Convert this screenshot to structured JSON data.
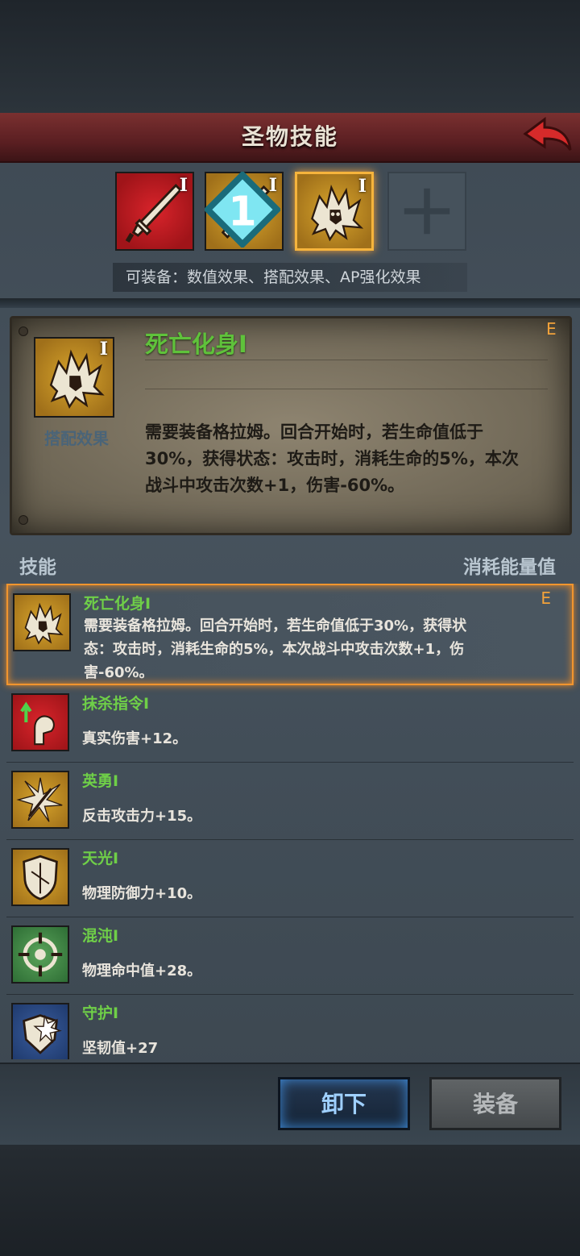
{
  "header": {
    "title": "圣物技能"
  },
  "slots": [
    {
      "icon": "sword-icon",
      "grade": "I",
      "color": "#c81e24"
    },
    {
      "icon": "broken-sword-icon",
      "grade": "I",
      "badge": "1",
      "color": "#c8922a"
    },
    {
      "icon": "death-skull-icon",
      "grade": "I",
      "selected": true,
      "color": "#c8922a"
    },
    {
      "icon": "empty-cross-icon",
      "empty": true
    }
  ],
  "equip_hint": "可装备：数值效果、搭配效果、AP强化效果",
  "detail": {
    "name": "死亡化身Ⅰ",
    "grade": "E",
    "type": "搭配效果",
    "icon_grade": "I",
    "description": "需要装备格拉姆。回合开始时，若生命值低于30%，获得状态：攻击时，消耗生命的5%，本次战斗中攻击次数+1，伤害-60%。"
  },
  "list_header": {
    "left": "技能",
    "right": "消耗能量值"
  },
  "skills": [
    {
      "name": "死亡化身Ⅰ",
      "desc": "需要装备格拉姆。回合开始时，若生命值低于30%，获得状态：攻击时，消耗生命的5%，本次战斗中攻击次数+1，伤害-60%。",
      "grade": "E",
      "icon": "death-skull-icon"
    },
    {
      "name": "抹杀指令Ⅰ",
      "desc": "真实伤害+12。",
      "icon": "arm-strength-icon"
    },
    {
      "name": "英勇Ⅰ",
      "desc": "反击攻击力+15。",
      "icon": "arrow-burst-icon"
    },
    {
      "name": "天光Ⅰ",
      "desc": "物理防御力+10。",
      "icon": "shield-icon"
    },
    {
      "name": "混沌Ⅰ",
      "desc": "物理命中值+28。",
      "icon": "crosshair-icon"
    },
    {
      "name": "守护Ⅰ",
      "desc": "坚韧值+27",
      "icon": "guard-shield-icon"
    }
  ],
  "buttons": {
    "unequip": "卸下",
    "equip": "装备"
  }
}
